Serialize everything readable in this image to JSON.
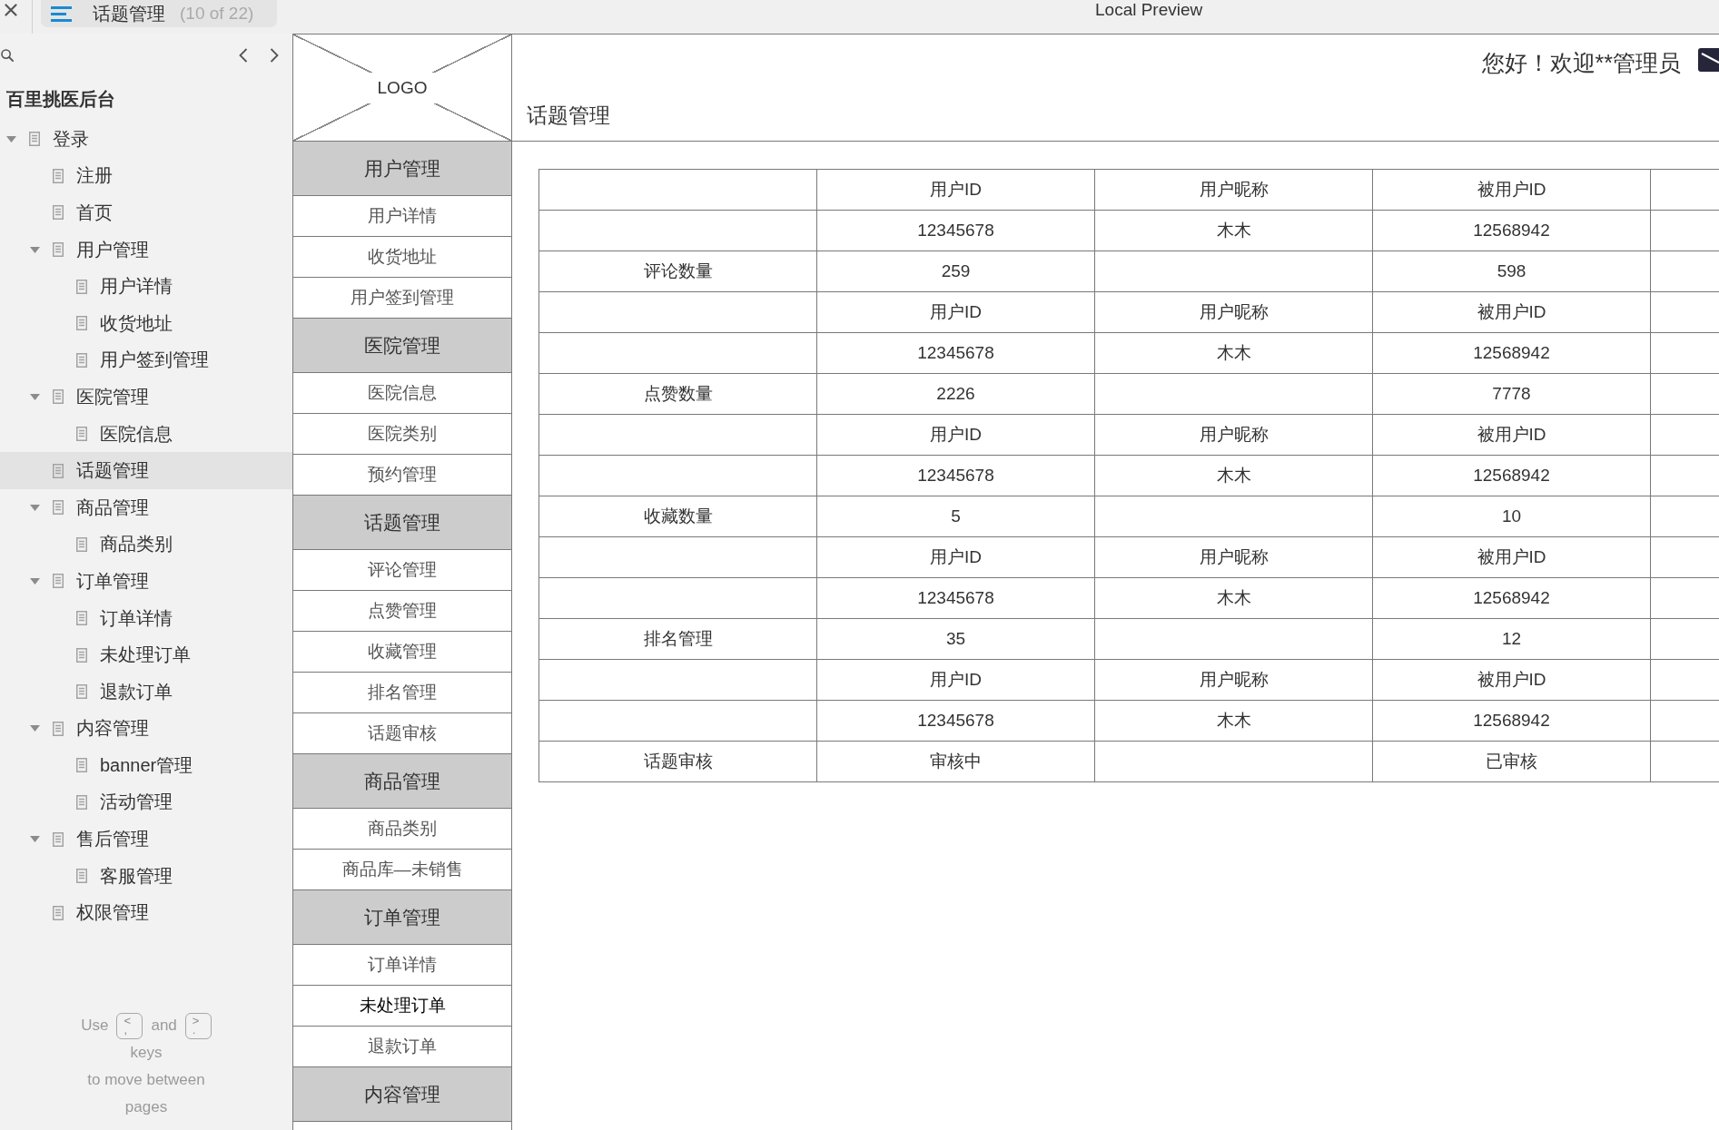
{
  "top_bar": {
    "tab": {
      "title": "话题管理",
      "counter": "(10 of 22)"
    },
    "preview_label": "Local Preview"
  },
  "sidebar": {
    "project_title": "百里挑医后台",
    "tree": [
      {
        "label": "登录",
        "expanded": true,
        "selected": false,
        "children": [
          {
            "label": "注册",
            "selected": false
          },
          {
            "label": "首页",
            "selected": false
          },
          {
            "label": "用户管理",
            "expanded": true,
            "selected": false,
            "children": [
              {
                "label": "用户详情",
                "selected": false
              },
              {
                "label": "收货地址",
                "selected": false
              },
              {
                "label": "用户签到管理",
                "selected": false
              }
            ]
          },
          {
            "label": "医院管理",
            "expanded": true,
            "selected": false,
            "children": [
              {
                "label": "医院信息",
                "selected": false
              }
            ]
          },
          {
            "label": "话题管理",
            "selected": true
          },
          {
            "label": "商品管理",
            "expanded": true,
            "selected": false,
            "children": [
              {
                "label": "商品类别",
                "selected": false
              }
            ]
          },
          {
            "label": "订单管理",
            "expanded": true,
            "selected": false,
            "children": [
              {
                "label": "订单详情",
                "selected": false
              },
              {
                "label": "未处理订单",
                "selected": false
              },
              {
                "label": "退款订单",
                "selected": false
              }
            ]
          },
          {
            "label": "内容管理",
            "expanded": true,
            "selected": false,
            "children": [
              {
                "label": "banner管理",
                "selected": false
              },
              {
                "label": "活动管理",
                "selected": false
              }
            ]
          },
          {
            "label": "售后管理",
            "expanded": true,
            "selected": false,
            "children": [
              {
                "label": "客服管理",
                "selected": false
              }
            ]
          },
          {
            "label": "权限管理",
            "selected": false
          }
        ]
      }
    ],
    "key_hint": {
      "parts": [
        {
          "kind": "text",
          "text": "Use"
        },
        {
          "kind": "key",
          "top": "<",
          "bottom": ","
        },
        {
          "kind": "text",
          "text": "and"
        },
        {
          "kind": "key",
          "top": ">",
          "bottom": "."
        }
      ],
      "lines": [
        "keys",
        "to move between",
        "pages"
      ]
    }
  },
  "app_nav": {
    "logo": "LOGO",
    "groups": [
      {
        "title": "用户管理",
        "items": [
          {
            "label": "用户详情",
            "selected": false
          },
          {
            "label": "收货地址",
            "selected": false
          },
          {
            "label": "用户签到管理",
            "selected": false
          }
        ]
      },
      {
        "title": "医院管理",
        "items": [
          {
            "label": "医院信息",
            "selected": false
          },
          {
            "label": "医院类别",
            "selected": false
          },
          {
            "label": "预约管理",
            "selected": false
          }
        ]
      },
      {
        "title": "话题管理",
        "items": [
          {
            "label": "评论管理",
            "selected": false
          },
          {
            "label": "点赞管理",
            "selected": false
          },
          {
            "label": "收藏管理",
            "selected": false
          },
          {
            "label": "排名管理",
            "selected": false
          },
          {
            "label": "话题审核",
            "selected": false
          }
        ]
      },
      {
        "title": "商品管理",
        "items": [
          {
            "label": "商品类别",
            "selected": false
          },
          {
            "label": "商品库—未销售",
            "selected": false
          }
        ]
      },
      {
        "title": "订单管理",
        "items": [
          {
            "label": "订单详情",
            "selected": false
          },
          {
            "label": "未处理订单",
            "selected": true
          },
          {
            "label": "退款订单",
            "selected": false
          }
        ]
      },
      {
        "title": "内容管理"
      }
    ]
  },
  "header": {
    "greeting": "您好！欢迎**管理员",
    "page_title": "话题管理"
  },
  "table": {
    "rows": [
      {
        "column_2": "用户ID",
        "column_3": "用户昵称",
        "column_4": "被用户ID"
      },
      {
        "column_2": "12345678",
        "column_3": "木木",
        "column_4": "12568942"
      },
      {
        "column_1": "评论数量",
        "column_2": "259",
        "column_4": "598"
      },
      {
        "column_2": "用户ID",
        "column_3": "用户昵称",
        "column_4": "被用户ID"
      },
      {
        "column_2": "12345678",
        "column_3": "木木",
        "column_4": "12568942"
      },
      {
        "column_1": "点赞数量",
        "column_2": "2226",
        "column_4": "7778"
      },
      {
        "column_2": "用户ID",
        "column_3": "用户昵称",
        "column_4": "被用户ID"
      },
      {
        "column_2": "12345678",
        "column_3": "木木",
        "column_4": "12568942"
      },
      {
        "column_1": "收藏数量",
        "column_2": "5",
        "column_4": "10"
      },
      {
        "column_2": "用户ID",
        "column_3": "用户昵称",
        "column_4": "被用户ID"
      },
      {
        "column_2": "12345678",
        "column_3": "木木",
        "column_4": "12568942"
      },
      {
        "column_1": "排名管理",
        "column_2": "35",
        "column_4": "12"
      },
      {
        "column_2": "用户ID",
        "column_3": "用户昵称",
        "column_4": "被用户ID"
      },
      {
        "column_2": "12345678",
        "column_3": "木木",
        "column_4": "12568942"
      },
      {
        "column_1": "话题审核",
        "column_2": "审核中",
        "column_4": "已审核"
      }
    ]
  }
}
